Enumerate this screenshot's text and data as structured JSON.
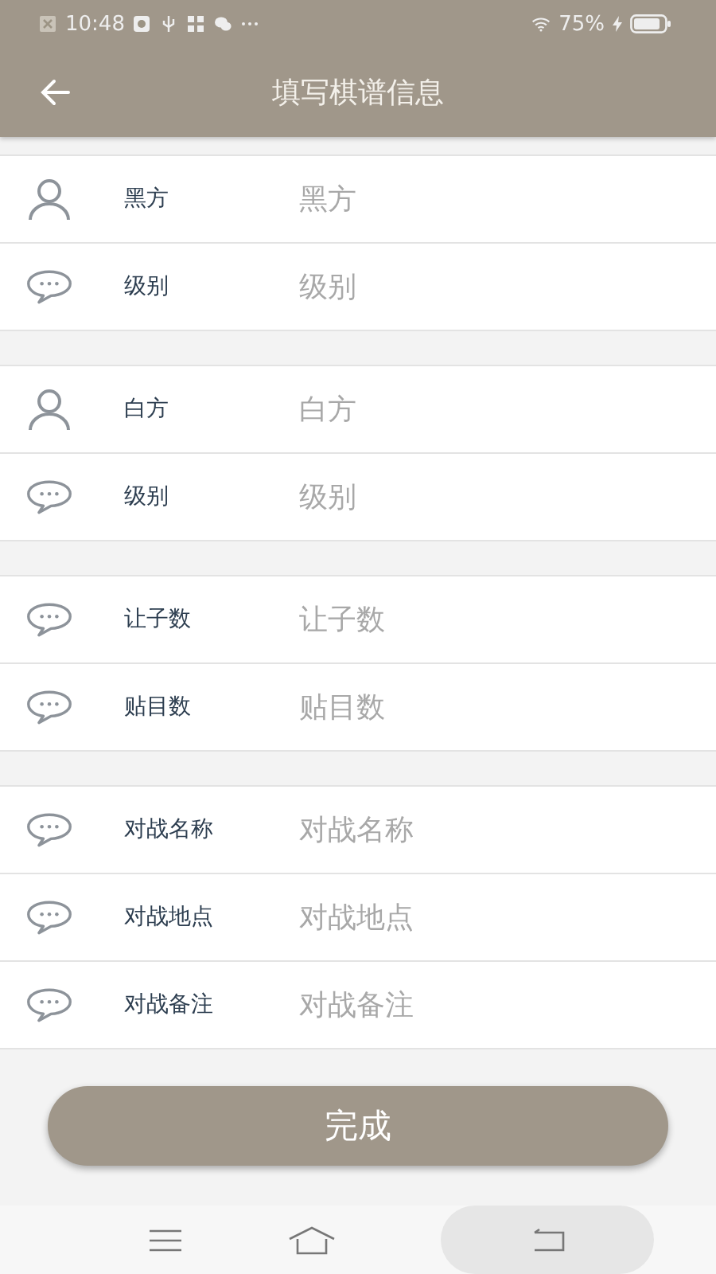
{
  "status_bar": {
    "time": "10:48",
    "battery": "75%"
  },
  "header": {
    "title": "填写棋谱信息"
  },
  "groups": [
    {
      "rows": [
        {
          "kind": "person",
          "label": "黑方",
          "placeholder": "黑方"
        },
        {
          "kind": "chat",
          "label": "级别",
          "placeholder": "级别"
        }
      ]
    },
    {
      "rows": [
        {
          "kind": "person",
          "label": "白方",
          "placeholder": "白方"
        },
        {
          "kind": "chat",
          "label": "级别",
          "placeholder": "级别"
        }
      ]
    },
    {
      "rows": [
        {
          "kind": "chat",
          "label": "让子数",
          "placeholder": "让子数"
        },
        {
          "kind": "chat",
          "label": "贴目数",
          "placeholder": "贴目数"
        }
      ]
    },
    {
      "rows": [
        {
          "kind": "chat",
          "label": "对战名称",
          "placeholder": "对战名称"
        },
        {
          "kind": "chat",
          "label": "对战地点",
          "placeholder": "对战地点"
        },
        {
          "kind": "chat",
          "label": "对战备注",
          "placeholder": "对战备注"
        }
      ]
    }
  ],
  "submit": {
    "label": "完成"
  }
}
